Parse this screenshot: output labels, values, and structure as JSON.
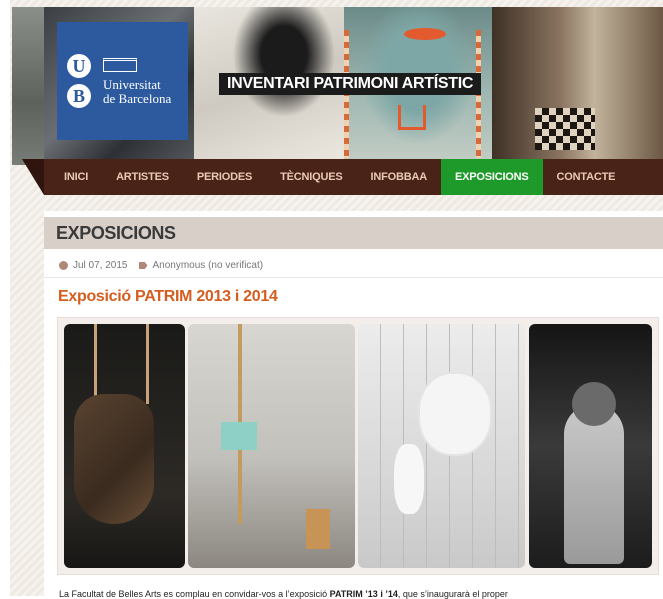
{
  "university": {
    "monogram_top": "U",
    "monogram_bottom": "B",
    "name": "Universitat\nde Barcelona"
  },
  "site": {
    "title": "INVENTARI PATRIMONI ARTÍSTIC"
  },
  "nav": {
    "items": [
      {
        "label": "INICI"
      },
      {
        "label": "ARTISTES"
      },
      {
        "label": "PERIODES"
      },
      {
        "label": "TÈCNIQUES"
      },
      {
        "label": "INFOBBAA"
      },
      {
        "label": "EXPOSICIONS",
        "active": true
      },
      {
        "label": "CONTACTE"
      }
    ]
  },
  "section": {
    "title": "EXPOSICIONS"
  },
  "post": {
    "date": "Jul 07, 2015",
    "author": "Anonymous (no verificat)",
    "title": "Exposició PATRIM 2013 i 2014",
    "intro_before": "La Facultat de Belles Arts es complau en convidar-vos a l’exposició ",
    "intro_bold": "PATRIM ’13 i ’14",
    "intro_after": ", que s’inaugurarà el proper"
  },
  "colors": {
    "nav_bg": "#4a2318",
    "nav_active": "#1e9a2a",
    "accent_title": "#d45e20",
    "ub_blue": "#2d5a9e"
  }
}
